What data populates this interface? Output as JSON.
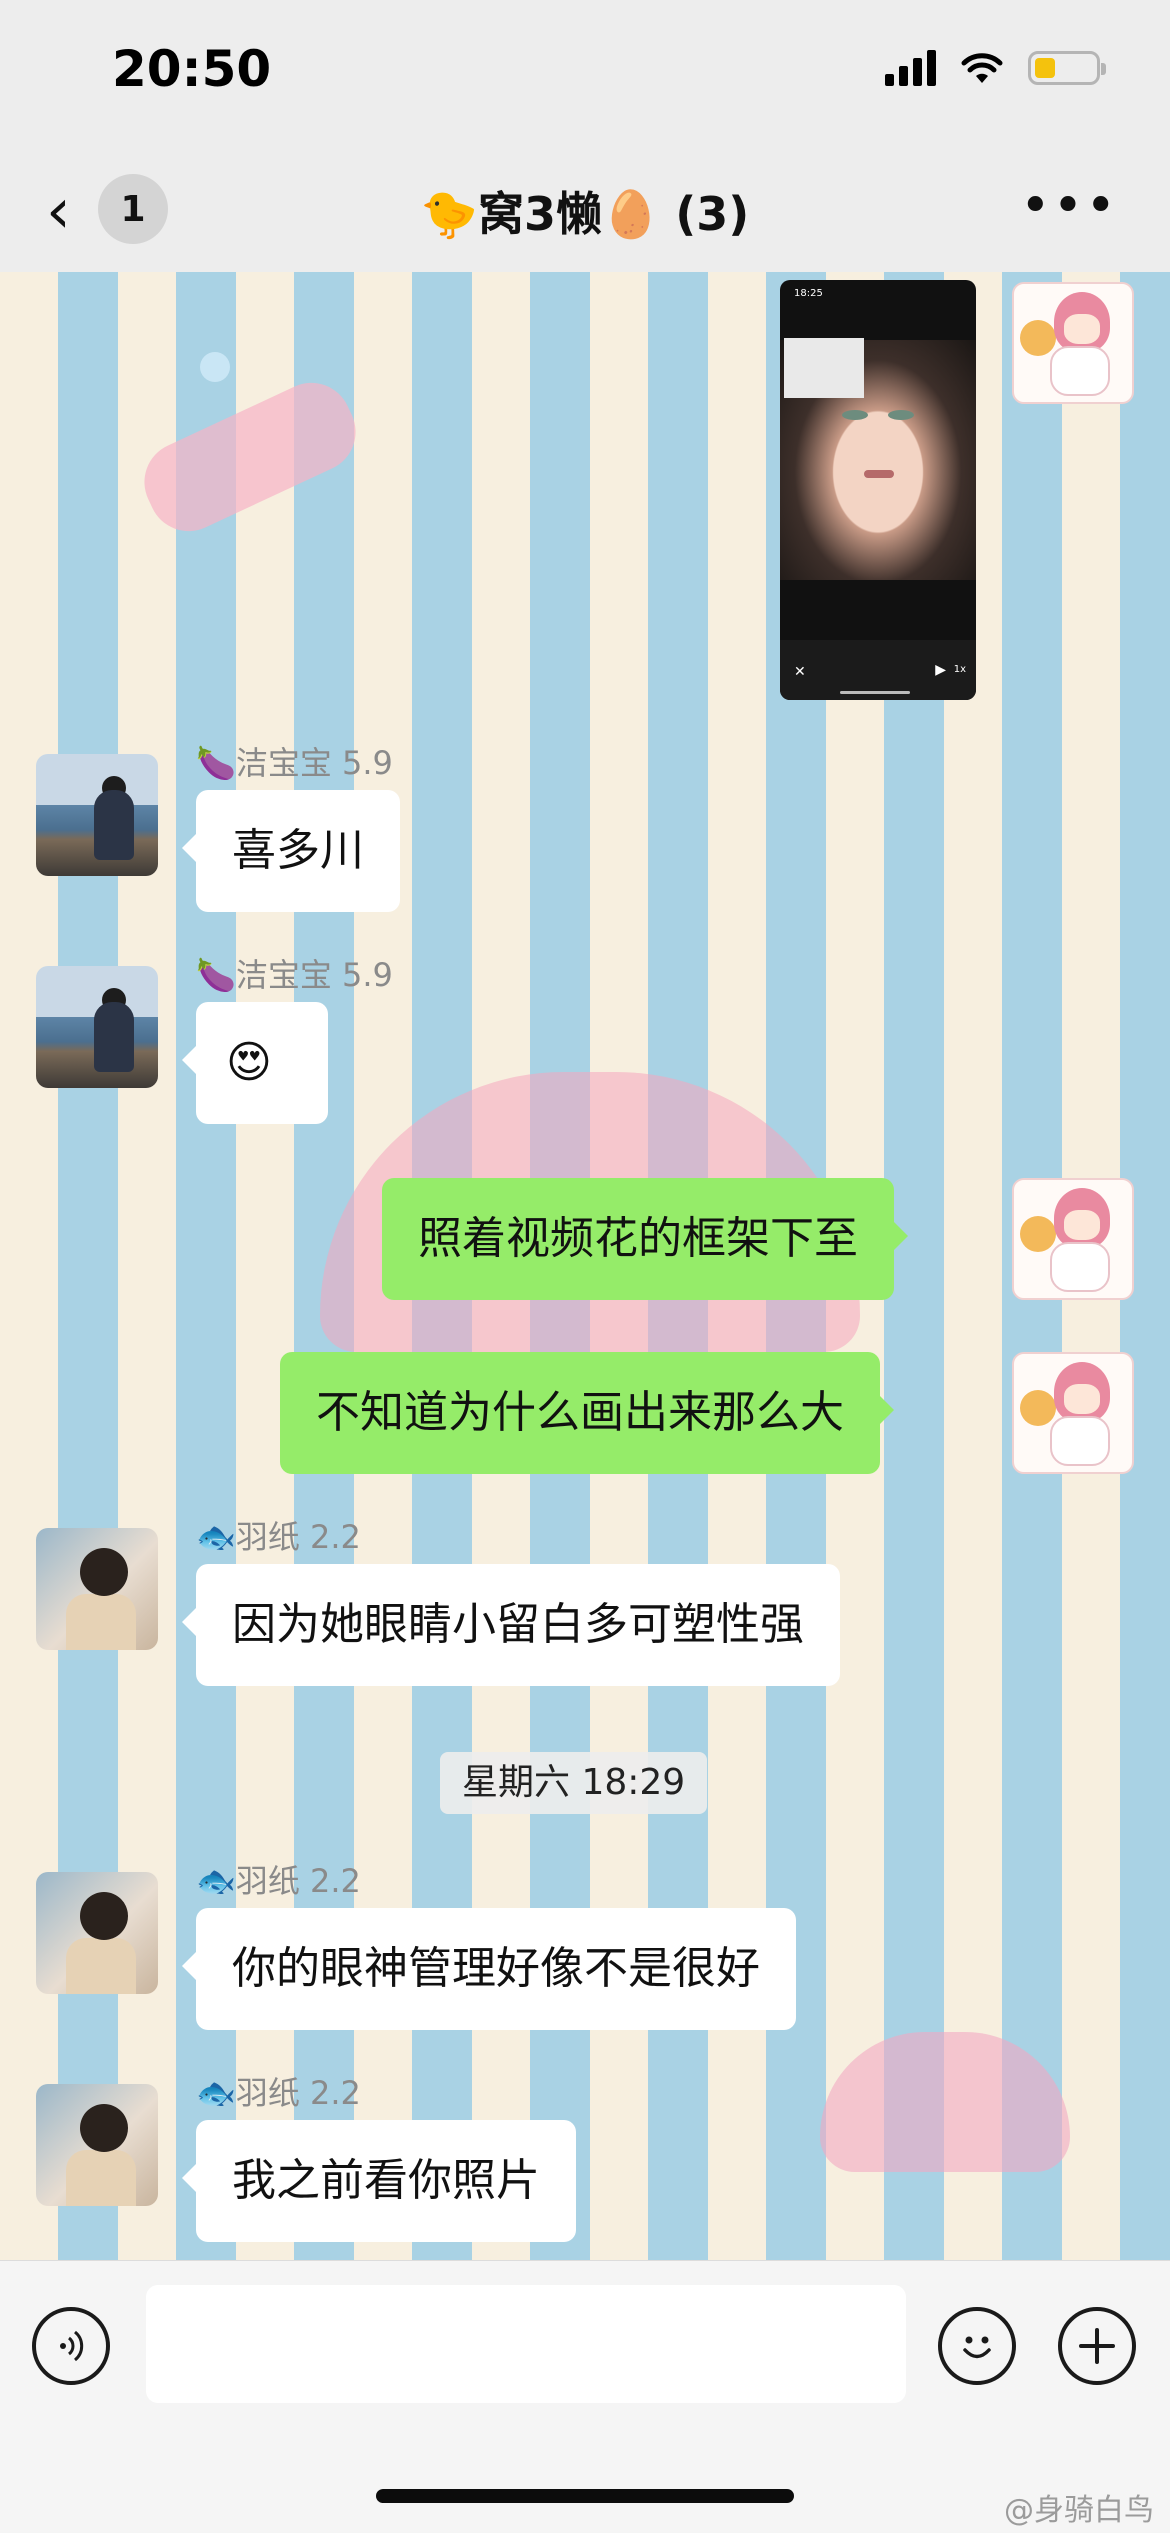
{
  "status": {
    "time": "20:50"
  },
  "header": {
    "back_count": "1",
    "title": "🐤窝3懒🥚 (3)",
    "more": "•••"
  },
  "chat": {
    "messages": [
      {
        "side": "me",
        "type": "video"
      },
      {
        "side": "them",
        "name": "🍆洁宝宝 5.9",
        "text": "喜多川"
      },
      {
        "side": "them",
        "name": "🍆洁宝宝 5.9",
        "text": "😍"
      },
      {
        "side": "me",
        "text": "照着视频花的框架下至"
      },
      {
        "side": "me",
        "text": "不知道为什么画出来那么大"
      },
      {
        "side": "them",
        "name": "🐟羽纸 2.2",
        "text": "因为她眼睛小留白多可塑性强"
      },
      {
        "side": "them",
        "name": "🐟羽纸 2.2",
        "text": "你的眼神管理好像不是很好"
      },
      {
        "side": "them",
        "name": "🐟羽纸 2.2",
        "text": "我之前看你照片"
      }
    ],
    "timestamp": "星期六 18:29",
    "video": {
      "time": "18:25",
      "close": "✕",
      "play": "▶",
      "speed": "1x"
    }
  },
  "input": {
    "voice_icon": "voice-icon",
    "emoji_icon": "emoji-icon",
    "plus_icon": "plus-icon"
  },
  "credit": "@身骑白鸟",
  "colors": {
    "my_bubble": "#95ec69",
    "their_bubble": "#ffffff",
    "stripe_blue": "#a9d2e4",
    "stripe_cream": "#f7efdf"
  }
}
